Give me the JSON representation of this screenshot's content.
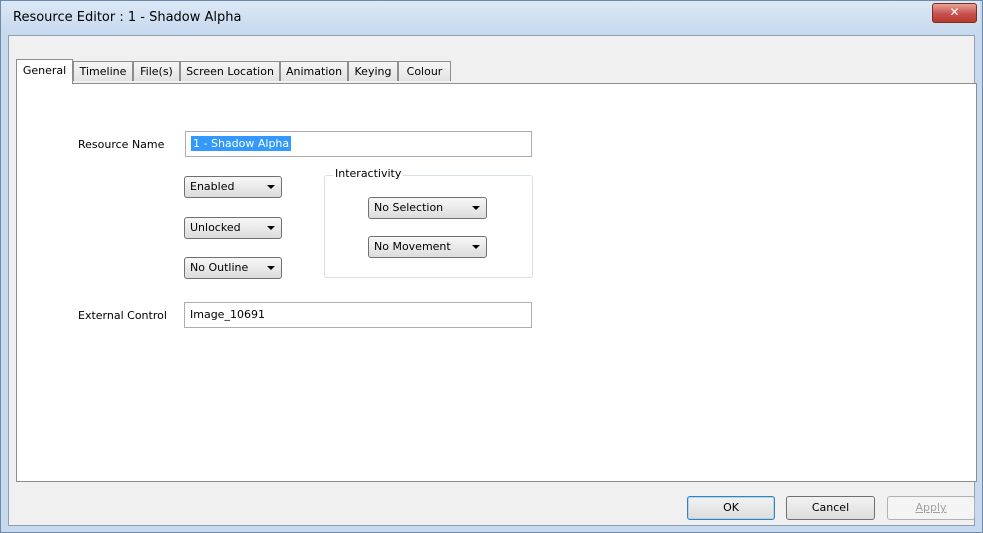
{
  "window": {
    "title": "Resource Editor  :  1 - Shadow Alpha",
    "close_glyph": "✕"
  },
  "tabs": [
    {
      "label": "General",
      "active": true
    },
    {
      "label": "Timeline",
      "active": false
    },
    {
      "label": "File(s)",
      "active": false
    },
    {
      "label": "Screen Location",
      "active": false
    },
    {
      "label": "Animation",
      "active": false
    },
    {
      "label": "Keying",
      "active": false
    },
    {
      "label": "Colour",
      "active": false
    }
  ],
  "general": {
    "resource_name_label": "Resource Name",
    "resource_name_value": "1 - Shadow Alpha",
    "enabled_select": "Enabled",
    "lock_select": "Unlocked",
    "outline_select": "No Outline",
    "interactivity_title": "Interactivity",
    "selection_select": "No Selection",
    "movement_select": "No Movement",
    "external_control_label": "External Control",
    "external_control_value": "Image_10691"
  },
  "buttons": {
    "ok": "OK",
    "cancel": "Cancel",
    "apply": "Apply"
  },
  "icons": {
    "close": "close-icon",
    "dropdown": "chevron-down-icon"
  }
}
